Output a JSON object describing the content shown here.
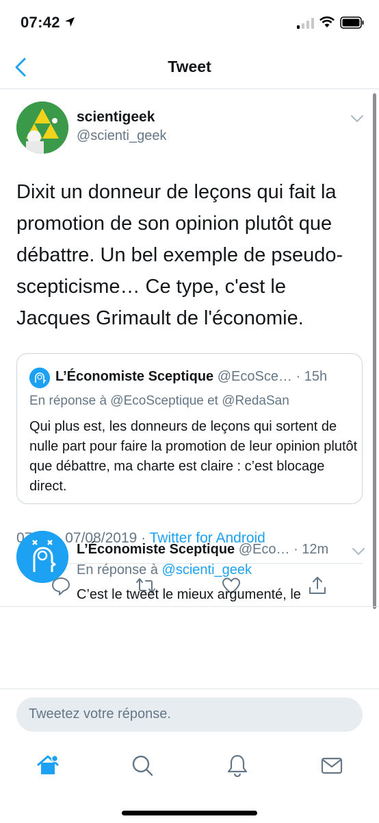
{
  "status_bar": {
    "time": "07:42"
  },
  "nav": {
    "title": "Tweet"
  },
  "tweet": {
    "display_name": "scientigeek",
    "handle": "@scienti_geek",
    "text": "Dixit un donneur de leçons qui fait la promotion de son opinion plutôt que débattre. Un bel exemple de pseudo-scepticisme… Ce type, c'est le Jacques Grimault de l'économie.",
    "timestamp": "07:26 · 07/08/2019 · ",
    "source": "Twitter for Android"
  },
  "quote": {
    "name": "L’Économiste Sceptique",
    "handle": "@EcoSce…",
    "time": "· 15h",
    "reply_to": "En réponse à @EcoSceptique et @RedaSan",
    "text": "Qui plus est, les donneurs de leçons qui sortent de nulle part pour faire la promotion de leur opinion plutôt que débattre, ma charte est claire : c’est blocage direct."
  },
  "reply": {
    "name": "L’Économiste Sceptique",
    "handle": "@Eco…",
    "time": "· 12m",
    "reply_prefix": "En réponse à ",
    "reply_link": "@scienti_geek",
    "text": "C’est le tweet le mieux argumenté, le"
  },
  "compose": {
    "placeholder": "Tweetez votre réponse."
  },
  "icons": {
    "back": "chevron-left-icon",
    "caret": "chevron-down-icon",
    "reply": "comment-icon",
    "retweet": "retweet-icon",
    "like": "heart-icon",
    "share": "share-icon",
    "home": "home-icon",
    "search": "search-icon",
    "notifications": "bell-icon",
    "messages": "mail-icon"
  },
  "colors": {
    "accent": "#1da1f2",
    "text_primary": "#14171a",
    "text_secondary": "#657786",
    "border": "#e1e8ed"
  }
}
